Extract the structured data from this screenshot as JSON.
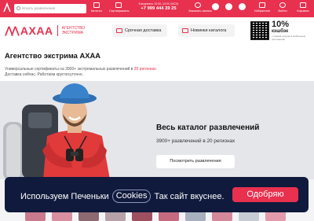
{
  "topbar": {
    "search_placeholder": "Искать развлечения",
    "items": [
      {
        "label": "Каталог",
        "icon": "catalog-icon"
      },
      {
        "label": "Сертификаты",
        "icon": "certificate-icon"
      }
    ],
    "phone_hours": "Ежедневно 10:00–19:00 (МСК)",
    "phone": "+7 999 444 39 25",
    "callback_label": "Заказать звонок",
    "right_items": [
      {
        "label": "Избранное",
        "icon": "heart-icon"
      },
      {
        "label": "Войти",
        "icon": "user-icon"
      },
      {
        "label": "Корзина",
        "icon": "cart-icon"
      }
    ],
    "accent_color": "#e8304f"
  },
  "header": {
    "brand_name": "АХАА",
    "brand_sub": "Агентство экстрима",
    "delivery_label": "Срочная доставка",
    "news_label": "Новинки каталога",
    "promo_percent": "10%",
    "promo_word": "кэшбэк",
    "promo_note": "с первой покупки в мобильном приложении"
  },
  "main": {
    "title": "Агентство экстрима АХАА",
    "desc_prefix": "Универсальные сертификаты на 3900+ экстремальных развлечений в ",
    "desc_highlight": "20 регионах",
    "desc_suffix": ".",
    "desc_line2": "Доставка сейчас. Работаем круглосуточно."
  },
  "hero": {
    "heading": "Весь каталог развлечений",
    "subheading": "3900+ развлечений в 20 регионах",
    "button_label": "Посмотреть развлечения",
    "bg_color": "#e5e6ea"
  },
  "cookie": {
    "text_before": "Используем Печеньки",
    "link_label": "Cookies",
    "text_after": "Так сайт вкуснее.",
    "accept_label": "Одобряю",
    "bg_color": "#101a3c"
  }
}
